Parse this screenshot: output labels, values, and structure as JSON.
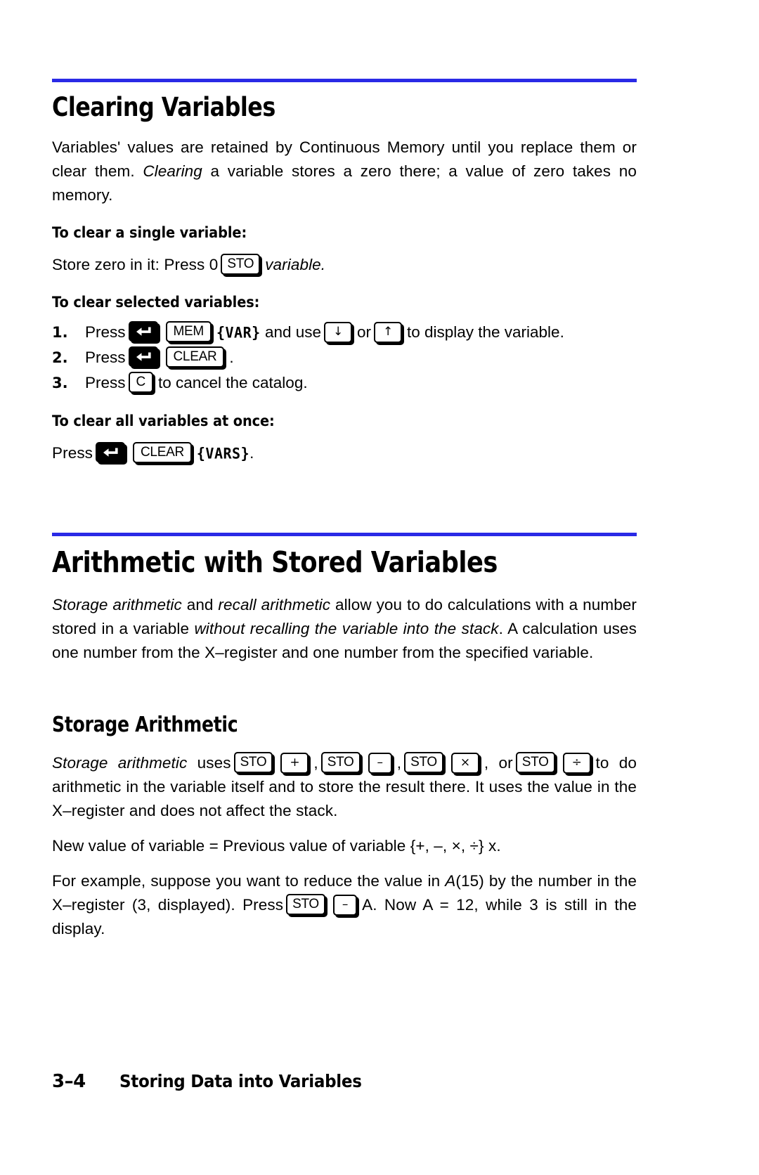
{
  "document": {
    "type": "calculator-user-manual-page",
    "accent_rule_color": "#2a2ae6",
    "page_background": "#ffffff",
    "text_color": "#000000"
  },
  "section_clearing": {
    "heading": "Clearing Variables",
    "intro_1": "Variables' values are retained by Continuous Memory until you replace them or clear them. ",
    "intro_italic": "Clearing",
    "intro_2": " a variable stores a zero there; a value of zero takes no memory.",
    "sub_single": "To clear a single variable:",
    "single_pre": "Store zero in it: Press 0",
    "single_key_sto": "STO",
    "single_post_italic": "variable.",
    "sub_selected": "To clear selected variables:",
    "steps": [
      {
        "num": "1.",
        "pre": "Press",
        "key_shift": "shift-left-arrow",
        "key_2": "MEM",
        "lcd": "{VAR}",
        "mid": "and use",
        "key_down": "↓",
        "between": "or",
        "key_up": "↑",
        "post": "to display the variable."
      },
      {
        "num": "2.",
        "pre": "Press",
        "key_shift": "shift-left-arrow",
        "key_2": "CLEAR",
        "post": "."
      },
      {
        "num": "3.",
        "pre": "Press",
        "key_2": "C",
        "post": "to cancel the catalog."
      }
    ],
    "sub_all": "To clear all variables at once:",
    "all_pre": "Press",
    "all_key_shift": "shift-left-arrow",
    "all_key_clear": "CLEAR",
    "all_lcd": "{VARS}",
    "all_post": "."
  },
  "section_arithmetic": {
    "heading": "Arithmetic with Stored Variables",
    "intro_i1": "Storage arithmetic",
    "intro_t1": " and ",
    "intro_i2": "recall arithmetic",
    "intro_t2": " allow you to do calculations with a number stored in a variable ",
    "intro_i3": "without recalling the variable into the stack",
    "intro_t3": ". A calculation uses one number from the X–register and one number from the specified variable."
  },
  "section_storage": {
    "heading": "Storage Arithmetic",
    "p1_italic": "Storage arithmetic",
    "p1_pre": " uses",
    "keys": [
      {
        "sto": "STO",
        "op": "+",
        "sep": ","
      },
      {
        "sto": "STO",
        "op": "–",
        "sep": ","
      },
      {
        "sto": "STO",
        "op": "×",
        "sep": ", or"
      },
      {
        "sto": "STO",
        "op": "÷",
        "sep": ""
      }
    ],
    "p1_post": "to do arithmetic in the variable itself and to store the result there. It uses the value in the X–register and does not affect the stack.",
    "p2": "New value of variable = Previous value of variable {+, –, ×, ÷} x.",
    "p3_a": "For example, suppose you want to reduce the value in ",
    "p3_a_italic": "A",
    "p3_b": "(15) by the number in the X–register (3, displayed). Press",
    "p3_key_sto": "STO",
    "p3_key_minus": "–",
    "p3_c": "A. Now A = 12, while 3 is still in the display."
  },
  "footer": {
    "page_number": "3–4",
    "title": "Storing Data into Variables"
  }
}
